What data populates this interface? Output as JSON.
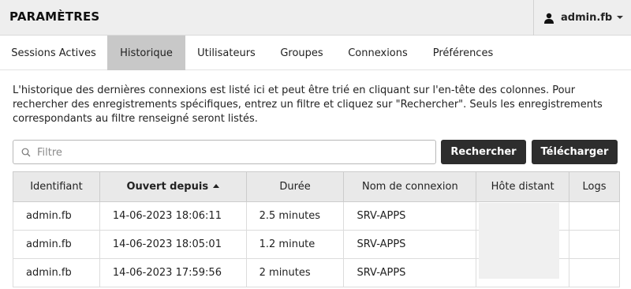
{
  "header": {
    "title": "PARAMÈTRES",
    "user": {
      "icon": "user-icon",
      "name": "admin.fb"
    }
  },
  "tabs": [
    {
      "label": "Sessions Actives",
      "active": false
    },
    {
      "label": "Historique",
      "active": true
    },
    {
      "label": "Utilisateurs",
      "active": false
    },
    {
      "label": "Groupes",
      "active": false
    },
    {
      "label": "Connexions",
      "active": false
    },
    {
      "label": "Préférences",
      "active": false
    }
  ],
  "description": "L'historique des dernières connexions est listé ici et peut être trié en cliquant sur l'en-tête des colonnes. Pour rechercher des enregistrements spécifiques, entrez un filtre et cliquez sur \"Rechercher\". Seuls les enregistrements correspondants au filtre renseigné seront listés.",
  "search": {
    "placeholder": "Filtre",
    "value": ""
  },
  "buttons": {
    "search_label": "Rechercher",
    "download_label": "Télécharger"
  },
  "table": {
    "columns": [
      "Identifiant",
      "Ouvert depuis",
      "Durée",
      "Nom de connexion",
      "Hôte distant",
      "Logs"
    ],
    "sorted_column": "Ouvert depuis",
    "rows": [
      {
        "user": "admin.fb",
        "opened": "14-06-2023 18:06:11",
        "duration": "2.5 minutes",
        "connection": "SRV-APPS",
        "host": "",
        "logs": ""
      },
      {
        "user": "admin.fb",
        "opened": "14-06-2023 18:05:01",
        "duration": "1.2 minute",
        "connection": "SRV-APPS",
        "host": "",
        "logs": ""
      },
      {
        "user": "admin.fb",
        "opened": "14-06-2023 17:59:56",
        "duration": "2 minutes",
        "connection": "SRV-APPS",
        "host": "",
        "logs": ""
      }
    ]
  }
}
